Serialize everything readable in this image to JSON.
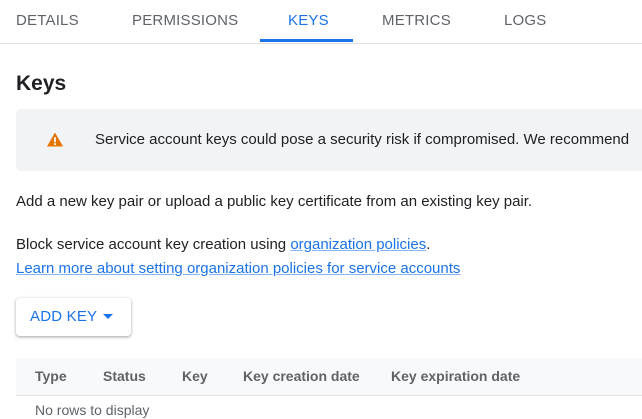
{
  "tabs": [
    {
      "label": "DETAILS"
    },
    {
      "label": "PERMISSIONS"
    },
    {
      "label": "KEYS"
    },
    {
      "label": "METRICS"
    },
    {
      "label": "LOGS"
    }
  ],
  "active_tab": "KEYS",
  "heading": "Keys",
  "banner": {
    "icon": "warning-icon",
    "icon_color": "#e37400",
    "text": "Service account keys could pose a security risk if compromised. We recommend"
  },
  "intro_text": "Add a new key pair or upload a public key certificate from an existing key pair.",
  "policy": {
    "prefix": "Block service account key creation using ",
    "link": "organization policies",
    "suffix": ".",
    "learn_more": "Learn more about setting organization policies for service accounts"
  },
  "add_key_button": {
    "label": "ADD KEY",
    "icon": "arrow-drop-down-icon"
  },
  "table": {
    "columns": [
      "Type",
      "Status",
      "Key",
      "Key creation date",
      "Key expiration date"
    ],
    "rows": [],
    "empty_text": "No rows to display"
  },
  "colors": {
    "accent": "#1a73e8",
    "warning": "#e37400"
  }
}
